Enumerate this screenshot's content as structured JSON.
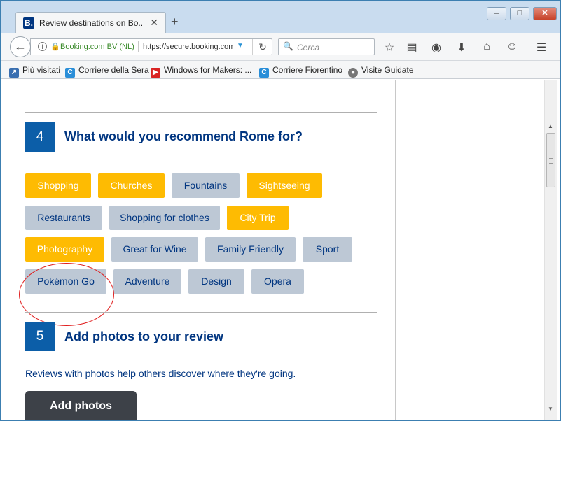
{
  "browser": {
    "tab_title": "Review destinations on Bo...",
    "favicon_letter": "B.",
    "tab_close": "✕",
    "new_tab": "+",
    "win_min": "–",
    "win_max": "□",
    "win_close": "✕",
    "back_icon": "←",
    "info_icon": "i",
    "lock_icon": "🔒",
    "site_identity": "Booking.com BV (NL)",
    "url": "https://secure.booking.com",
    "reload_icon": "↻",
    "search_placeholder": "Cerca",
    "toolbar_icons": [
      "star-icon",
      "reading-list-icon",
      "pocket-icon",
      "download-icon",
      "home-icon",
      "smiley-icon",
      "menu-icon"
    ]
  },
  "bookmarks": [
    {
      "label": "Più visitati",
      "icon": "most-visited-icon",
      "color": "#3a6fb0"
    },
    {
      "label": "Corriere della Sera",
      "icon": "corriere-icon",
      "color": "#2a8ed8"
    },
    {
      "label": "Windows for Makers: ...",
      "icon": "youtube-icon",
      "color": "#d92323"
    },
    {
      "label": "Corriere Fiorentino",
      "icon": "corriere-icon",
      "color": "#2a8ed8"
    },
    {
      "label": "Visite Guidate",
      "icon": "globe-icon",
      "color": "#777777"
    }
  ],
  "step4": {
    "number": "4",
    "title": "What would you recommend Rome for?",
    "tags": [
      {
        "label": "Shopping",
        "selected": true
      },
      {
        "label": "Churches",
        "selected": true
      },
      {
        "label": "Fountains",
        "selected": false
      },
      {
        "label": "Sightseeing",
        "selected": true
      },
      {
        "label": "Restaurants",
        "selected": false
      },
      {
        "label": "Shopping for clothes",
        "selected": false
      },
      {
        "label": "City Trip",
        "selected": true
      },
      {
        "label": "Photography",
        "selected": true
      },
      {
        "label": "Great for Wine",
        "selected": false
      },
      {
        "label": "Family Friendly",
        "selected": false
      },
      {
        "label": "Sport",
        "selected": false
      },
      {
        "label": "Pokémon Go",
        "selected": false
      },
      {
        "label": "Adventure",
        "selected": false
      },
      {
        "label": "Design",
        "selected": false
      },
      {
        "label": "Opera",
        "selected": false
      }
    ]
  },
  "step5": {
    "number": "5",
    "title": "Add photos to your review",
    "description": "Reviews with photos help others discover where they're going.",
    "button_label": "Add photos"
  },
  "colors": {
    "brand_blue": "#003580",
    "selected_tag": "#febb02",
    "unselected_tag": "#bdc8d5",
    "annotation_red": "#e01b1b"
  }
}
